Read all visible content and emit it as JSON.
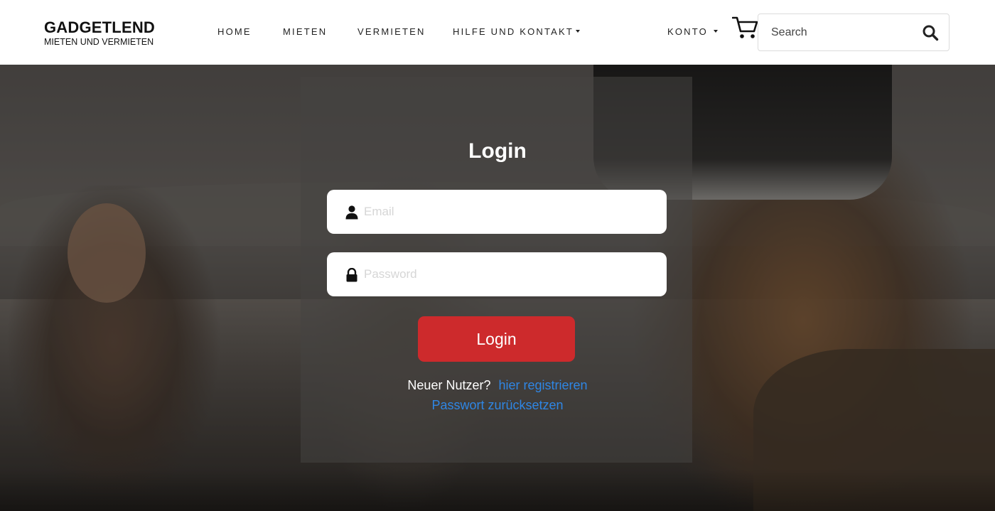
{
  "brand": {
    "title": "GADGETLEND",
    "subtitle": "MIETEN UND VERMIETEN"
  },
  "nav": {
    "home": "HOME",
    "mieten": "MIETEN",
    "vermieten": "VERMIETEN",
    "hilfe": "HILFE UND KONTAKT",
    "konto": "KONTO"
  },
  "search": {
    "placeholder": "Search"
  },
  "icons": {
    "cart": "shopping-cart-icon",
    "search": "magnifier-icon",
    "user": "user-icon",
    "lock": "lock-icon"
  },
  "login": {
    "title": "Login",
    "email_placeholder": "Email",
    "password_placeholder": "Password",
    "button": "Login",
    "new_user_text": "Neuer Nutzer?",
    "register_link": "hier registrieren",
    "reset_link": "Passwort zurücksetzen"
  },
  "colors": {
    "primary_button": "#cd2a2c",
    "link": "#2f86e4",
    "header_bg": "#ffffff"
  }
}
